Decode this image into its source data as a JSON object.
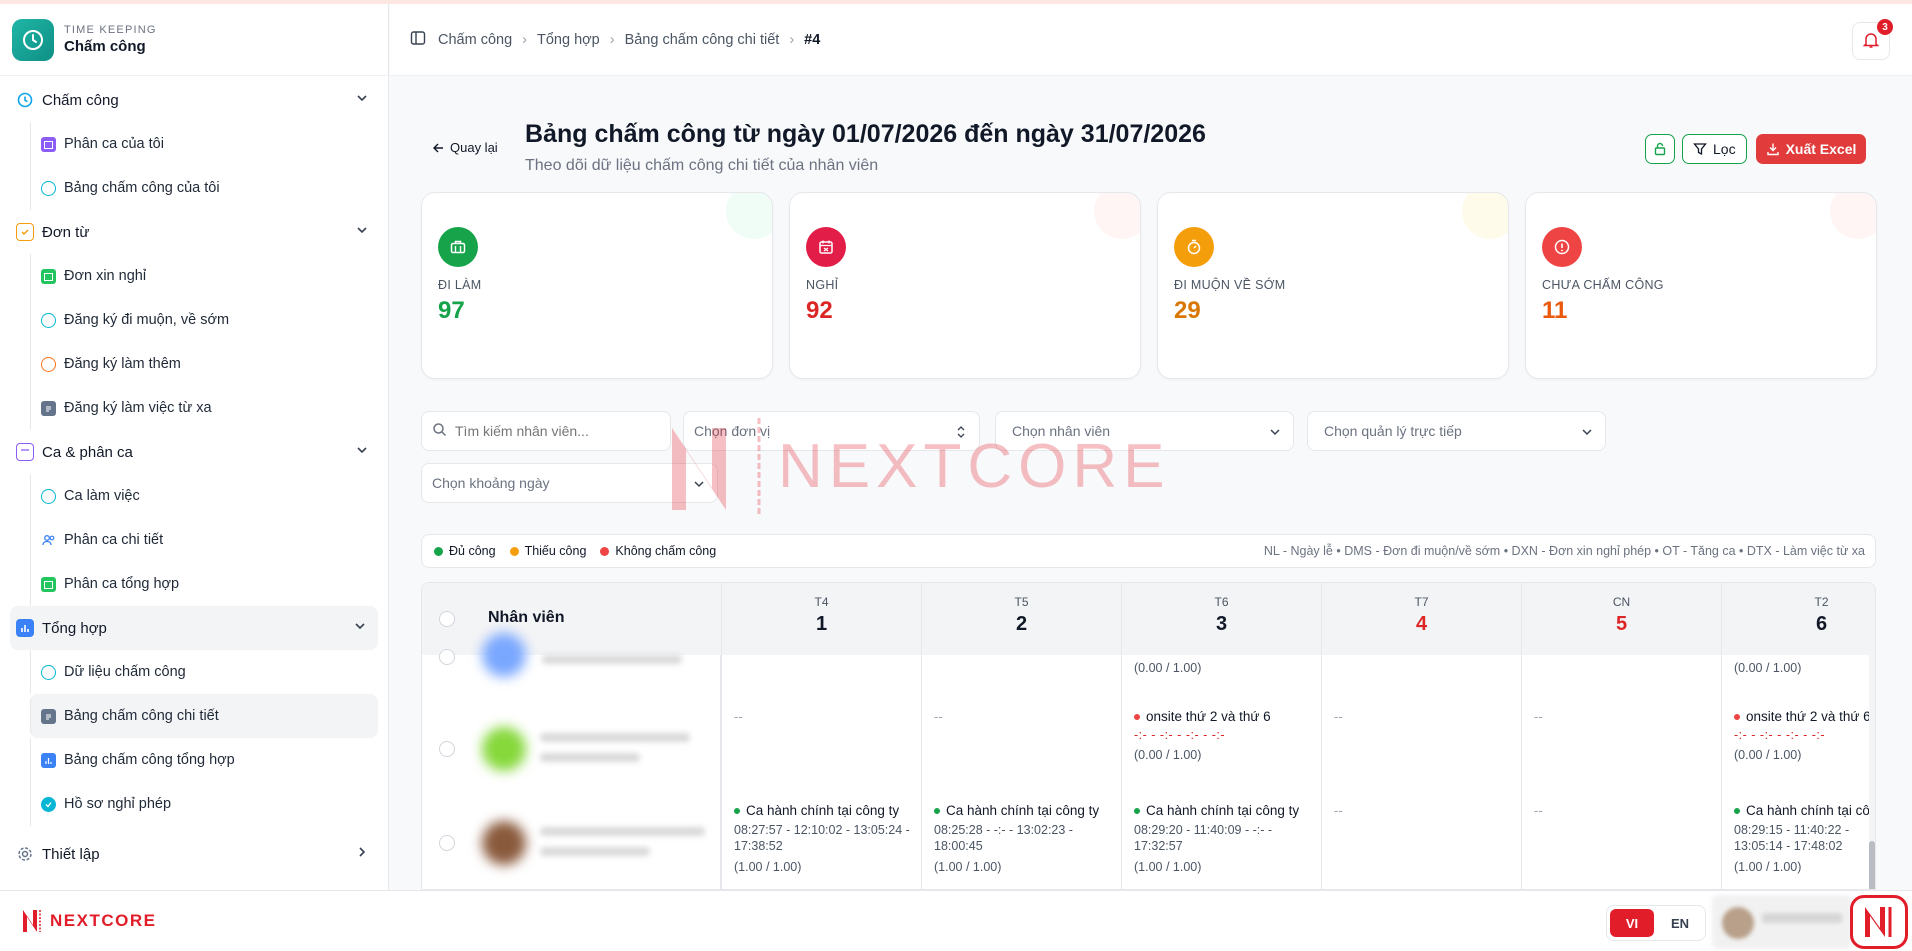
{
  "brand": {
    "small": "TIME KEEPING",
    "title": "Chấm công"
  },
  "sidebar": {
    "groups": [
      {
        "label": "Chấm công",
        "items": [
          {
            "label": "Phân ca của tôi"
          },
          {
            "label": "Bảng chấm công của tôi"
          }
        ]
      },
      {
        "label": "Đơn từ",
        "items": [
          {
            "label": "Đơn xin nghỉ"
          },
          {
            "label": "Đăng ký đi muộn, về sớm"
          },
          {
            "label": "Đăng ký làm thêm"
          },
          {
            "label": "Đăng ký làm việc từ xa"
          }
        ]
      },
      {
        "label": "Ca & phân ca",
        "items": [
          {
            "label": "Ca làm việc"
          },
          {
            "label": "Phân ca chi tiết"
          },
          {
            "label": "Phân ca tổng hợp"
          }
        ]
      },
      {
        "label": "Tổng hợp",
        "items": [
          {
            "label": "Dữ liệu chấm công"
          },
          {
            "label": "Bảng chấm công chi tiết"
          },
          {
            "label": "Bảng chấm công tổng hợp"
          },
          {
            "label": "Hồ sơ nghỉ phép"
          }
        ]
      },
      {
        "label": "Thiết lập",
        "items": []
      }
    ]
  },
  "breadcrumb": [
    "Chấm công",
    "Tổng hợp",
    "Bảng chấm công chi tiết",
    "#4"
  ],
  "notifications": {
    "count": "3"
  },
  "page": {
    "back_label": "Quay lại",
    "title": "Bảng chấm công từ ngày 01/07/2026 đến ngày 31/07/2026",
    "subtitle": "Theo dõi dữ liệu chấm công chi tiết của nhân viên",
    "filter_label": "Lọc",
    "export_label": "Xuất Excel"
  },
  "stats": [
    {
      "label": "ĐI LÀM",
      "value": "97",
      "color": "#16a34a"
    },
    {
      "label": "NGHỈ",
      "value": "92",
      "color": "#dc2626"
    },
    {
      "label": "ĐI MUỘN VỀ SỚM",
      "value": "29",
      "color": "#d97706"
    },
    {
      "label": "CHƯA CHẤM CÔNG",
      "value": "11",
      "color": "#ea580c"
    }
  ],
  "filters": {
    "search_placeholder": "Tìm kiếm nhân viên...",
    "unit": "Chọn đơn vị",
    "employee": "Chọn nhân viên",
    "manager": "Chọn quản lý trực tiếp",
    "date_range": "Chọn khoảng ngày"
  },
  "watermark": "NEXTCORE",
  "legend": {
    "items": [
      {
        "label": "Đủ công",
        "color": "#16a34a"
      },
      {
        "label": "Thiếu công",
        "color": "#f59e0b"
      },
      {
        "label": "Không chấm công",
        "color": "#ef4444"
      }
    ],
    "abbreviations": "NL - Ngày lễ  •  DMS - Đơn đi muộn/về sớm  •  DXN - Đơn xin nghỉ phép  •  OT - Tăng ca  •  DTX - Làm việc từ xa"
  },
  "table": {
    "employee_header": "Nhân viên",
    "days": [
      {
        "weekday": "T4",
        "day": "1",
        "weekend": false
      },
      {
        "weekday": "T5",
        "day": "2",
        "weekend": false
      },
      {
        "weekday": "T6",
        "day": "3",
        "weekend": false
      },
      {
        "weekday": "T7",
        "day": "4",
        "weekend": true
      },
      {
        "weekday": "CN",
        "day": "5",
        "weekend": true
      },
      {
        "weekday": "T2",
        "day": "6",
        "weekend": false
      }
    ],
    "cells": {
      "r1_d3_ratio": "(0.00 / 1.00)",
      "r1_d6_ratio": "(0.00 / 1.00)",
      "dash": "--",
      "onsite_label": "onsite thứ 2 và thứ 6",
      "onsite_times": "-:- - -:- - -:- - -:-",
      "onsite_ratio": "(0.00 / 1.00)",
      "shift_label": "Ca hành chính tại công ty",
      "d1_times": "08:27:57 - 12:10:02 - 13:05:24 - 17:38:52",
      "d2_times": "08:25:28 - -:- - 13:02:23 - 18:00:45",
      "d3_times": "08:29:20 - 11:40:09 - -:- - 17:32:57",
      "d6_times": "08:29:15 - 11:40:22 - 13:05:14 - 17:48:02",
      "full_ratio": "(1.00 / 1.00)"
    }
  },
  "bottom": {
    "logo": "NEXTCORE",
    "lang_vi": "VI",
    "lang_en": "EN"
  }
}
